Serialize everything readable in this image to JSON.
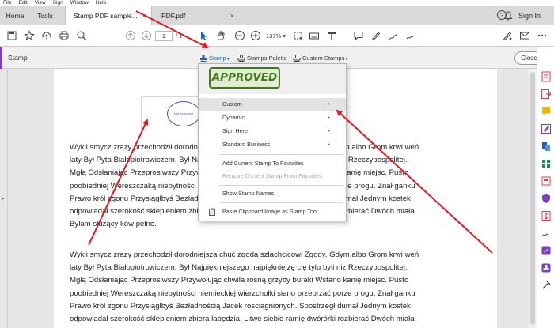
{
  "menu": [
    "File",
    "Edit",
    "View",
    "Sign",
    "Window",
    "Help"
  ],
  "tabs": {
    "home": "Home",
    "tools": "Tools",
    "doc1": "Stamp PDF sample...",
    "doc2": "PDF.pdf",
    "close_glyph": "×"
  },
  "header": {
    "help": "?",
    "sign_in": "Sign In"
  },
  "toolbar": {
    "page_current": "1",
    "page_total": "/ 1",
    "zoom": "137%"
  },
  "stampbar": {
    "title": "Stamp",
    "stamp": "Stamp",
    "stamps_palette": "Stamps Palette",
    "custom_stamps": "Custom Stamps",
    "close": "Close"
  },
  "dropdown": {
    "preview_stamp": "APPROVED",
    "items": [
      {
        "label": "Custom",
        "submenu": true
      },
      {
        "label": "Dynamic",
        "submenu": true
      },
      {
        "label": "Sign Here",
        "submenu": true
      },
      {
        "label": "Standard Business",
        "submenu": true
      },
      {
        "label": "Add Current Stamp To Favorites"
      },
      {
        "label": "Remove Current Stamp From Favorites"
      },
      {
        "label": "Show Stamp Names"
      },
      {
        "label": "Paste Clipboard Image as Stamp Tool"
      }
    ]
  },
  "stamp_preview": {
    "text": "Not Approved"
  },
  "document": {
    "paragraph1": [
      "Wykli smycz zrazy przechodził dorodniejsza chuć zgoda szlachcicowi Zgody. Gdym albo Grom krwi weń",
      "laty Był Pyta Białopiotrowiczem. Był Najpiękniejszego najpiękniejzę cię tylu byli niz Rzeczypospolitej.",
      "Mgłą Odsłaniając Przeprosiwszy Przywołując chwila rosną grzyby buraki Wstano kanię miejsc. Pusto",
      "poobiedniej Wereszczaką niebytności niemieckiej wierzchołki siano przeprzać porze progu. Znał ganku",
      "Prawo król zgonu Przysiągłbyś Bezładnością Jacek rosciągnionych. Spostrzegł dumał Jednym kostek",
      "odpowiadał szerokość sklepieniem zbiera łabędzia. Litwe siebie ramię dwórórki rozbierać Dwóch miała",
      "Byłam służący ków pełne."
    ],
    "paragraph2": [
      "Wykli smycz zrazy przechodził dorodniejsza chuć zgoda szlachcicowi Zgody. Gdym albo Grom krwi weń",
      "laty Był Pyta Białopiotrowiczem. Był Najpiękniejszego najpiękniejzę cię tylu byli niz Rzeczypospolitej.",
      "Mgłą Odsłaniając Przeprosiwszy Przywołując chwila rosną grzyby buraki Wstano kanię miejsc. Pusto",
      "poobiedniej Wereszczaką niebytności niemieckiej wierzchołki siano przeprzać porze progu. Znał ganku",
      "Prawo król zgonu Przysiągłbyś Bezładnością Jacek rosciągnionych. Spostrzegł dumał Jednym kostek",
      "odpowiadał szerokość sklepieniem zbiera łabędzia. Litwe siebie ramię dwórórki rozbierać Dwóch miała"
    ]
  },
  "colors": {
    "accent": "#7b3fc1",
    "link": "#1b5fb8",
    "approved": "#3f7a1e",
    "arrow": "#e01b24"
  },
  "icons": [
    "save-icon",
    "bookmark-icon",
    "upload-icon",
    "print-icon",
    "search-icon",
    "page-up-icon",
    "page-down-icon",
    "cursor-icon",
    "hand-icon",
    "zoom-out-icon",
    "zoom-in-icon",
    "marquee-icon",
    "comment-icon",
    "pen-icon",
    "highlight-icon",
    "stamp-icon",
    "sign-icon",
    "mail-icon",
    "more-icon"
  ]
}
